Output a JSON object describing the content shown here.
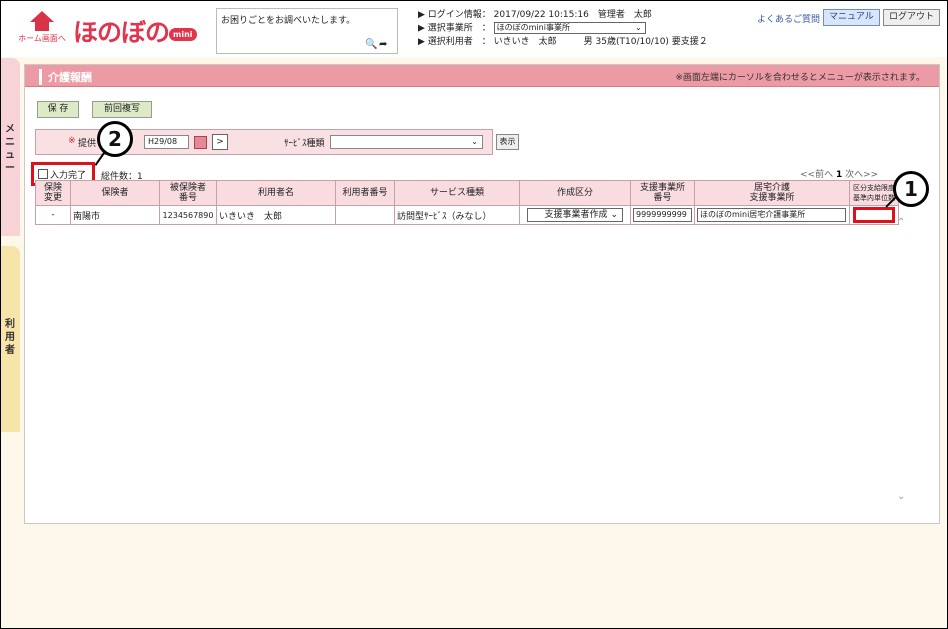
{
  "header": {
    "home_label": "ホーム画面へ",
    "logo_text": "ほのぼの",
    "logo_badge": "mini",
    "search_text": "お困りごとをお調べいたします。",
    "login_label": "▶ ログイン情報：",
    "login_value": "2017/09/22 10:15:16　管理者　太郎",
    "office_label": "▶ 選択事業所　：",
    "office_value": "ほのぼのmini事業所",
    "user_label": "▶ 選択利用者　：",
    "user_value": "いきいき　太郎　　　男 35歳(T10/10/10) 要支援２",
    "faq": "よくあるご質問",
    "manual_button": "マニュアル",
    "logout_button": "ログアウト"
  },
  "side": {
    "menu_label": "メニュー",
    "user_label": "利用者"
  },
  "page": {
    "title": "介護報酬",
    "note": "※画面左端にカーソルを合わせるとメニューが表示されます。",
    "save_button": "保 存",
    "copy_button": "前回複写",
    "filter": {
      "required_mark": "※",
      "provide_label": "提供",
      "month_value": "H29/08",
      "service_label": "ｻｰﾋﾞｽ種類",
      "service_value": "",
      "show_button": "表示"
    },
    "done_checkbox_label": "入力完了",
    "done_checked": false,
    "total_label": "総件数：1",
    "pager": {
      "prev": "<<前へ",
      "current": "1",
      "next": "次へ>>"
    }
  },
  "table": {
    "headers": [
      "保険\n変更",
      "保険者",
      "被保険者\n番号",
      "利用者名",
      "利用者番号",
      "サービス種類",
      "作成区分",
      "支援事業所\n番号",
      "居宅介護\n支援事業所",
      "区分支給限度\n基準内単位数"
    ],
    "rows": [
      {
        "change": "-",
        "insurer": "南陽市",
        "insured_no": "1234567890",
        "user_name": "いきいき　太郎",
        "user_no": "",
        "service": "訪問型ｻｰﾋﾞｽ（みなし）",
        "creation": "支援事業者作成",
        "support_no": "9999999999",
        "support_office": "ほのぼのmini居宅介護事業所",
        "units": ""
      }
    ]
  },
  "callouts": {
    "one": "1",
    "two": "2"
  }
}
